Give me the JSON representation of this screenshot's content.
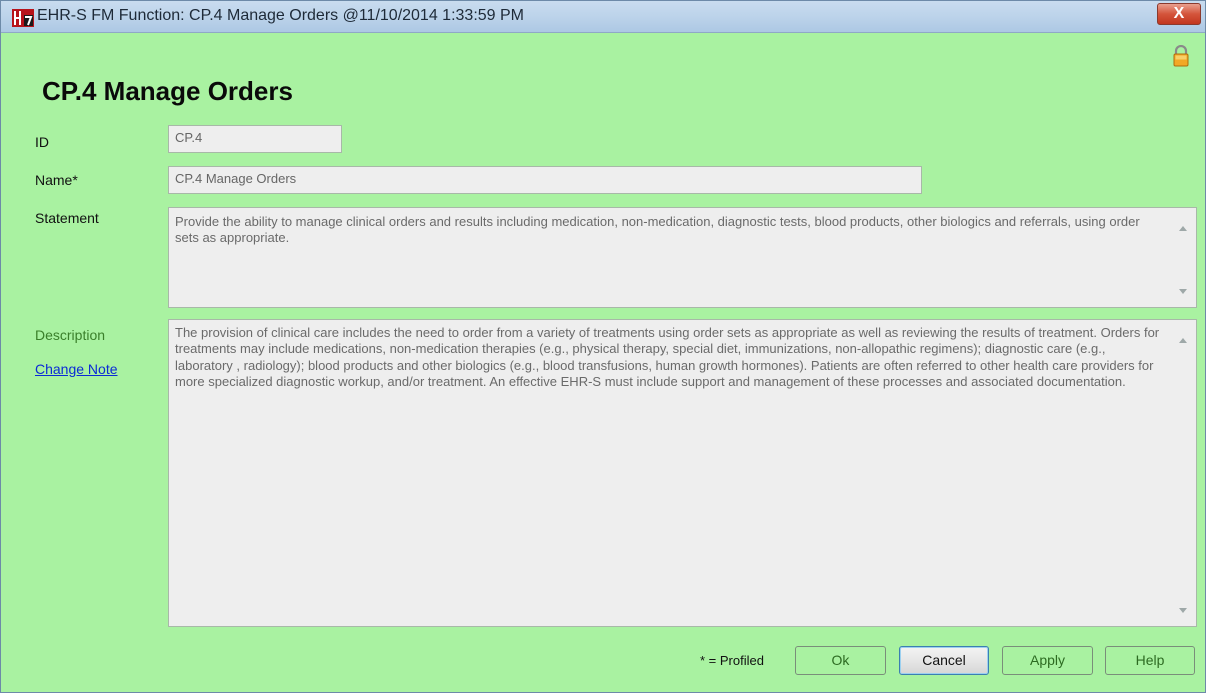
{
  "window": {
    "title": "EHR-S FM Function: CP.4 Manage Orders @11/10/2014 1:33:59 PM",
    "close_label": "X",
    "colors": {
      "background": "#a9f2a1",
      "titlebar": "#bcd3ea"
    }
  },
  "form": {
    "heading": "CP.4 Manage Orders",
    "id_label": "ID",
    "id_value": "CP.4",
    "name_label": "Name*",
    "name_value": "CP.4 Manage Orders",
    "statement_label": "Statement",
    "statement_value": "Provide the ability to manage clinical orders and results including medication, non-medication, diagnostic tests, blood products, other biologics and referrals, using order sets as appropriate.",
    "description_label": "Description",
    "change_note_link": "Change Note",
    "description_value": "The provision of clinical care includes the need to order from a variety of treatments using order sets as appropriate as well as reviewing the results of treatment. Orders for treatments may include medications, non-medication therapies (e.g., physical therapy, special diet, immunizations, non-allopathic regimens); diagnostic care (e.g., laboratory , radiology); blood products and other biologics (e.g., blood transfusions, human growth hormones). Patients are often referred to other health care providers for more specialized diagnostic workup, and/or treatment. An effective EHR-S must include support and management of these processes and associated documentation."
  },
  "footer": {
    "profiled_note": "* = Profiled",
    "ok_label": "Ok",
    "cancel_label": "Cancel",
    "apply_label": "Apply",
    "help_label": "Help"
  },
  "icons": [
    "hl7-app-icon",
    "close-icon",
    "lock-icon",
    "scroll-up-icon",
    "scroll-down-icon"
  ]
}
